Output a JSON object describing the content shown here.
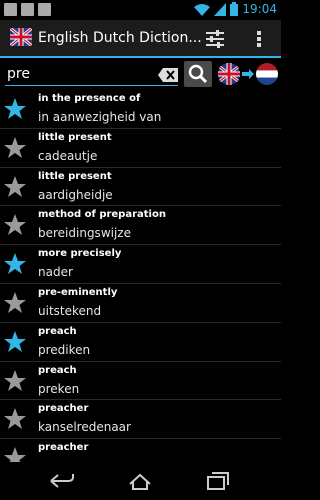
{
  "status_bar": {
    "time": "19:04"
  },
  "app": {
    "title": "English Dutch Diction..."
  },
  "search": {
    "value": "pre",
    "placeholder": ""
  },
  "colors": {
    "accent": "#33b5e5",
    "star_active": "#33b5e5",
    "star_inactive": "#9a9a9a"
  },
  "entries": [
    {
      "en": "in the presence of",
      "nl": "in aanwezigheid van",
      "favorite": true
    },
    {
      "en": "little present",
      "nl": "cadeautje",
      "favorite": false
    },
    {
      "en": "little present",
      "nl": "aardigheidje",
      "favorite": false
    },
    {
      "en": "method of preparation",
      "nl": "bereidingswijze",
      "favorite": false
    },
    {
      "en": "more precisely",
      "nl": "nader",
      "favorite": true
    },
    {
      "en": "pre-eminently",
      "nl": "uitstekend",
      "favorite": false
    },
    {
      "en": "preach",
      "nl": "prediken",
      "favorite": true
    },
    {
      "en": "preach",
      "nl": "preken",
      "favorite": false
    },
    {
      "en": "preacher",
      "nl": "kanselredenaar",
      "favorite": false
    },
    {
      "en": "preacher",
      "nl": "",
      "favorite": false
    }
  ],
  "icons": {
    "app": "uk-flag-icon",
    "settings": "sliders-icon",
    "overflow": "overflow-menu-icon",
    "clear": "backspace-clear-icon",
    "search": "magnifier-icon",
    "from_lang": "uk-flag-icon",
    "arrow": "arrow-right-icon",
    "to_lang": "netherlands-flag-icon",
    "back": "back-icon",
    "home": "home-icon",
    "recents": "recents-icon"
  }
}
